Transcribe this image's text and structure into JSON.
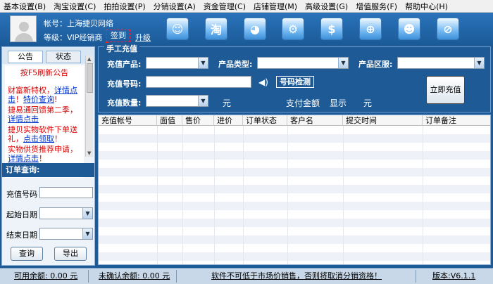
{
  "menu": [
    "基本设置(B)",
    "淘宝设置(C)",
    "拍拍设置(P)",
    "分销设置(A)",
    "资金管理(C)",
    "店铺管理(M)",
    "高级设置(G)",
    "增值服务(F)",
    "帮助中心(H)"
  ],
  "account": {
    "account_line": "帐号：上海捷贝网络",
    "level_line": "等级：VIP经销商",
    "signin": "签到",
    "upgrade": "升级"
  },
  "toolbar_icons": [
    "user-agent-icon",
    "taobao-icon",
    "chat-icon",
    "settings-icon",
    "yuan-icon",
    "search-icon",
    "users-icon",
    "disable-icon"
  ],
  "toolbar_glyphs": [
    "☺",
    "淘",
    "◕",
    "⚙",
    "$",
    "⊕",
    "☻",
    "⊘"
  ],
  "left_panel": {
    "tab_notice": "公告",
    "tab_status": "状态",
    "refresh_hint": "按F5刷新公告",
    "notices": [
      {
        "red": "财富新特权，",
        "blue": "详情点击",
        "red2": "！",
        "blue2": "特价查询",
        "red3": "!"
      },
      {
        "red": "捷易通回馈第二季，",
        "blue": "详情点击",
        "red2": "",
        "blue2": "",
        "red3": ""
      },
      {
        "red": "捷贝实物软件下单送礼，",
        "blue": "点击领取",
        "red2": "！",
        "blue2": "",
        "red3": ""
      },
      {
        "red": "实物供货推荐申请，",
        "blue": "详情点击",
        "red2": "！",
        "blue2": "",
        "red3": ""
      }
    ],
    "order_query_title": "订单查询:",
    "field_phone": "充值号码",
    "field_start": "起始日期",
    "field_end": "结束日期",
    "btn_query": "查询",
    "btn_export": "导出"
  },
  "manual": {
    "legend": "手工充值",
    "product": "充值产品:",
    "type": "产品类型:",
    "region": "产品区服:",
    "phone": "充值号码:",
    "check_number": "号码检测",
    "quantity": "充值数量:",
    "unit": "元",
    "pay_amount": "支付金额",
    "show": "显示",
    "unit2": "元",
    "recharge_now": "立即充值"
  },
  "table": {
    "columns": [
      "充值帐号",
      "面值",
      "售价",
      "进价",
      "订单状态",
      "客户名",
      "提交时间",
      "订单备注"
    ],
    "rows": []
  },
  "statusbar": {
    "available": "可用余额: 0.00 元",
    "unconfirmed": "未确认余额: 0.00 元",
    "warning": "软件不可低于市场价销售，否则将取消分销资格！",
    "version": "版本:V6.1.1"
  }
}
